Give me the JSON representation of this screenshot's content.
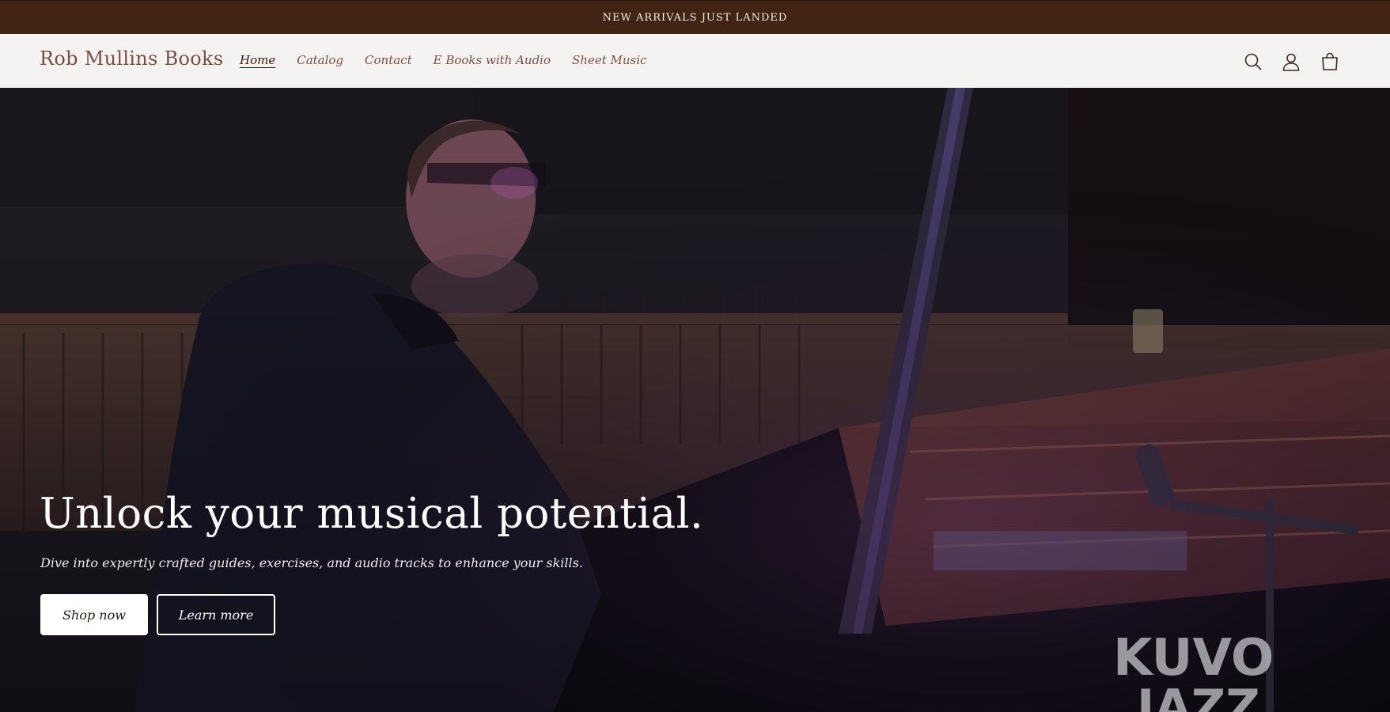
{
  "announcement": {
    "text": "NEW ARRIVALS JUST LANDED"
  },
  "header": {
    "brand": "Rob Mullins Books",
    "nav": [
      {
        "label": "Home",
        "active": true
      },
      {
        "label": "Catalog",
        "active": false
      },
      {
        "label": "Contact",
        "active": false
      },
      {
        "label": "E Books with Audio",
        "active": false
      },
      {
        "label": "Sheet Music",
        "active": false
      }
    ],
    "icons": [
      "search-icon",
      "account-icon",
      "cart-icon"
    ]
  },
  "hero": {
    "title": "Unlock your musical potential.",
    "subtitle": "Dive into expertly crafted guides, exercises, and audio tracks to enhance your skills.",
    "primary_button": "Shop now",
    "secondary_button": "Learn more",
    "watermark_line1": "KUVO",
    "watermark_line2": "JAZZ"
  },
  "colors": {
    "announcement_bg": "#412413",
    "header_bg": "#f4f3f1",
    "brand_text": "#7b4f44"
  }
}
